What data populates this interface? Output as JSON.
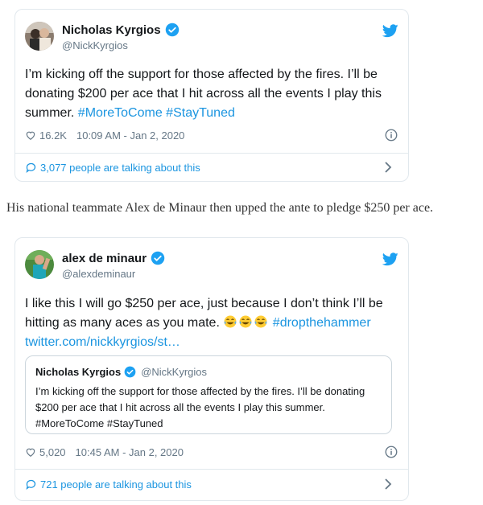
{
  "tweet1": {
    "author_name": "Nicholas Kyrgios",
    "handle": "@NickKyrgios",
    "text_main": "I’m kicking off the support for those affected by the fires. I’ll be donating $200 per ace that I hit across all the events I play this summer. ",
    "hashtags": "#MoreToCome #StayTuned",
    "likes": "16.2K",
    "timestamp": "10:09 AM - Jan 2, 2020",
    "talking": "3,077 people are talking about this"
  },
  "between_text": "His national teammate Alex de Minaur then upped the ante to pledge $250 per ace.",
  "tweet2": {
    "author_name": "alex de minaur",
    "handle": "@alexdeminaur",
    "text_main": "I like this I will go $250 per ace, just because I don’t think I’ll be hitting as many aces as you mate. ",
    "hashtag": "#dropthehammer",
    "link_text": "twitter.com/nickkyrgios/st…",
    "likes": "5,020",
    "timestamp": "10:45 AM - Jan 2, 2020",
    "talking": "721 people are talking about this",
    "quote": {
      "author_name": "Nicholas Kyrgios",
      "handle": "@NickKyrgios",
      "text": "I’m kicking off the support for those affected by the fires. I’ll be donating $200 per ace that I hit across all the events I play this summer. #MoreToCome #StayTuned"
    }
  },
  "colors": {
    "link": "#1b95e0",
    "verified": "#1da1f2",
    "secondary": "#657786",
    "border": "#e1e8ed"
  },
  "icons": [
    "verified-badge-icon",
    "twitter-bird-icon",
    "heart-icon",
    "info-icon",
    "speech-bubble-icon",
    "chevron-right-icon",
    "tears-of-joy-emoji-icon"
  ]
}
